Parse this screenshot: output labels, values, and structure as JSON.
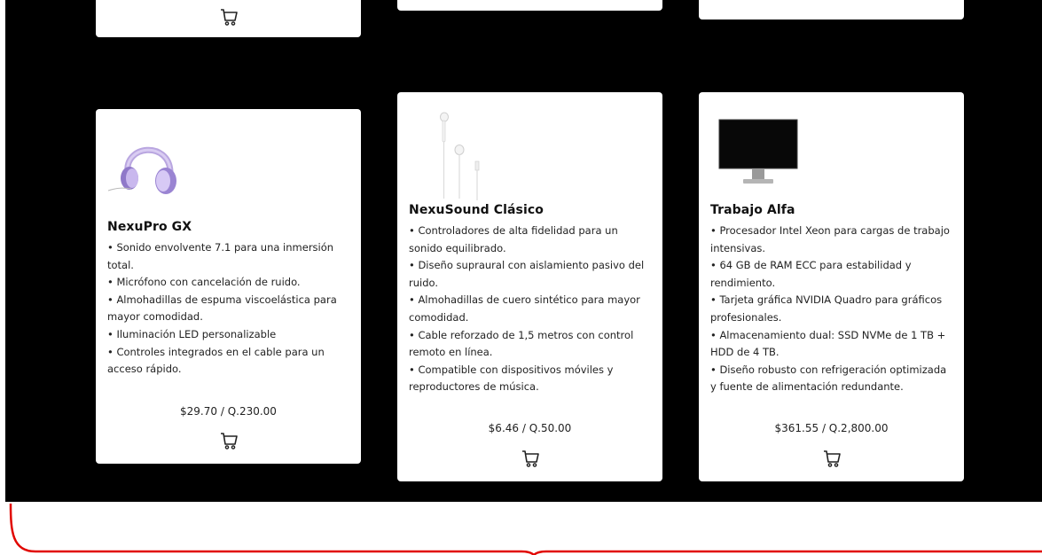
{
  "products": [
    {
      "name": "NexuPro GX",
      "features": [
        "• Sonido envolvente 7.1 para una inmersión total.",
        "• Micrófono con cancelación de ruido.",
        "• Almohadillas de espuma viscoelástica para mayor comodidad.",
        "• Iluminación LED personalizable",
        "• Controles integrados en el cable para un acceso rápido."
      ],
      "price": "$29.70 / Q.230.00",
      "image": "purple-headphones-image"
    },
    {
      "name": "NexuSound Clásico",
      "features": [
        "• Controladores de alta fidelidad para un sonido equilibrado.",
        "• Diseño supraural con aislamiento pasivo del ruido.",
        "• Almohadillas de cuero sintético para mayor comodidad.",
        "• Cable reforzado de 1,5 metros con control remoto en línea.",
        "• Compatible con dispositivos móviles y reproductores de música."
      ],
      "price": "$6.46 / Q.50.00",
      "image": "white-earphones-image"
    },
    {
      "name": "Trabajo Alfa",
      "features": [
        "• Procesador Intel Xeon para cargas de trabajo intensivas.",
        "• 64 GB de RAM ECC para estabilidad y rendimiento.",
        "• Tarjeta gráfica NVIDIA Quadro para gráficos profesionales.",
        "• Almacenamiento dual: SSD NVMe de 1 TB + HDD de 4 TB.",
        "• Diseño robusto con refrigeración optimizada y fuente de alimentación redundante."
      ],
      "price": "$361.55 / Q.2,800.00",
      "image": "desktop-monitor-image"
    }
  ],
  "icons": {
    "cart": "shopping-cart-icon"
  },
  "colors": {
    "background": "#000000",
    "card": "#ffffff",
    "bracket": "#e10600"
  }
}
